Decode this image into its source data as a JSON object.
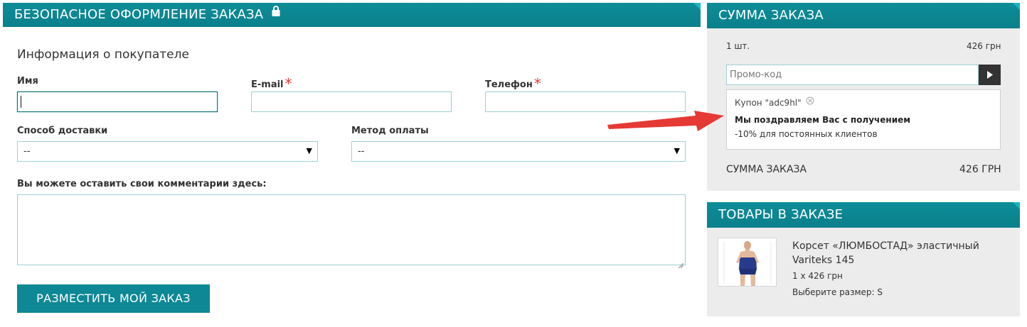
{
  "checkout": {
    "title": "БЕЗОПАСНОЕ ОФОРМЛЕНИЕ ЗАКАЗА",
    "section_title": "Информация о покупателе",
    "name_label": "Имя",
    "email_label": "E-mail",
    "phone_label": "Телефон",
    "required_mark": "*",
    "delivery_label": "Способ доставки",
    "delivery_value": "--",
    "payment_label": "Метод оплаты",
    "payment_value": "--",
    "comment_label": "Вы можете оставить свои комментарии здесь:",
    "submit_label": "РАЗМЕСТИТЬ МОЙ ЗАКАЗ",
    "select_arrow": "▼"
  },
  "order_summary": {
    "title": "СУММА ЗАКАЗА",
    "quantity": "1 шт.",
    "amount": "426 грн",
    "promo_placeholder": "Промо-код",
    "coupon_text": "Купон \"adc9hl\"",
    "congrats_text": "Мы поздравляем Вас с получением",
    "discount_text": "-10% для постоянных клиентов",
    "total_label": "СУММА ЗАКАЗА",
    "total_value": "426 ГРН"
  },
  "order_items": {
    "title": "ТОВАРЫ В ЗАКАЗЕ",
    "items": [
      {
        "name_line1": "Корсет «ЛЮМБОСТАД» эластичный",
        "name_line2": "Variteks 145",
        "qty_price": "1 x 426 грн",
        "size": "Выберите размер: S"
      }
    ]
  },
  "colors": {
    "accent": "#0a808b",
    "annotation_arrow": "#e53935"
  },
  "icons": [
    "lock-icon",
    "play-icon",
    "remove-coupon-icon",
    "resize-grip-icon",
    "annotation-arrow"
  ]
}
